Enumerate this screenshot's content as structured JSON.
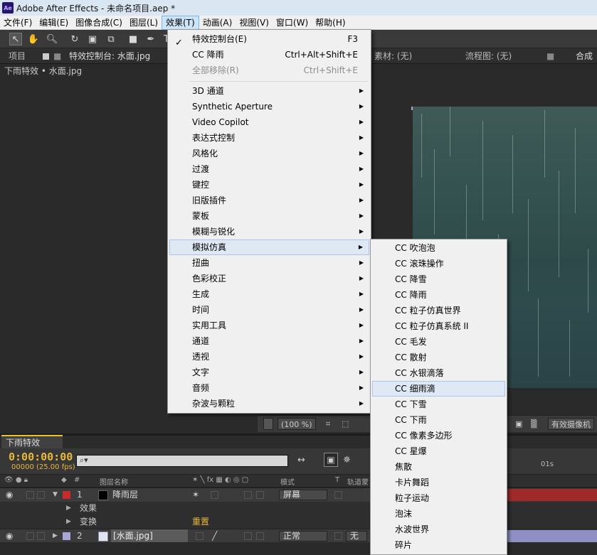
{
  "window": {
    "app_icon": "Ae",
    "title": "Adobe After Effects - 未命名项目.aep *"
  },
  "menubar": [
    "文件(F)",
    "编辑(E)",
    "图像合成(C)",
    "图层(L)",
    "效果(T)",
    "动画(A)",
    "视图(V)",
    "窗口(W)",
    "帮助(H)"
  ],
  "panels": {
    "project_tab": "项目",
    "effect_controls_tab": "特效控制台: 水面.jpg",
    "footage_tab": "素材: (无)",
    "flowchart_tab": "流程图: (无)",
    "composition_tab": "合成",
    "effect_controls_subtitle": "下雨特效 • 水面.jpg"
  },
  "viewer_footer": {
    "zoom": "(100 %)",
    "camera": "有效摄像机"
  },
  "timeline": {
    "tab": "下雨特效",
    "timecode": "0:00:00:00",
    "frame_info": "00000 (25.00 fps)",
    "search_placeholder": "",
    "header": {
      "layer_name": "图层名称",
      "mode": "模式",
      "t": "T",
      "trkmat": "轨道蒙"
    },
    "ruler_label": "01s",
    "layers": [
      {
        "index": "1",
        "name": "降雨层",
        "label_color": "#c82b2b",
        "mode": "屏幕"
      },
      {
        "index": "2",
        "name": "[水面.jpg]",
        "label_color": "#a7a7d6",
        "mode": "正常",
        "trkmat": "无"
      }
    ],
    "effects_label": "效果",
    "transform_label": "变换",
    "reset_label": "重置"
  },
  "effects_menu": {
    "items": [
      {
        "label": "特效控制台(E)",
        "shortcut": "F3",
        "checked": true
      },
      {
        "label": "CC 降雨",
        "shortcut": "Ctrl+Alt+Shift+E"
      },
      {
        "label": "全部移除(R)",
        "shortcut": "Ctrl+Shift+E",
        "disabled": true
      },
      {
        "label": "3D 通道",
        "submenu": true
      },
      {
        "label": "Synthetic Aperture",
        "submenu": true
      },
      {
        "label": "Video Copilot",
        "submenu": true
      },
      {
        "label": "表达式控制",
        "submenu": true
      },
      {
        "label": "风格化",
        "submenu": true
      },
      {
        "label": "过渡",
        "submenu": true
      },
      {
        "label": "键控",
        "submenu": true
      },
      {
        "label": "旧版插件",
        "submenu": true
      },
      {
        "label": "蒙板",
        "submenu": true
      },
      {
        "label": "模糊与锐化",
        "submenu": true
      },
      {
        "label": "模拟仿真",
        "submenu": true,
        "highlighted": true
      },
      {
        "label": "扭曲",
        "submenu": true
      },
      {
        "label": "色彩校正",
        "submenu": true
      },
      {
        "label": "生成",
        "submenu": true
      },
      {
        "label": "时间",
        "submenu": true
      },
      {
        "label": "实用工具",
        "submenu": true
      },
      {
        "label": "通道",
        "submenu": true
      },
      {
        "label": "透视",
        "submenu": true
      },
      {
        "label": "文字",
        "submenu": true
      },
      {
        "label": "音频",
        "submenu": true
      },
      {
        "label": "杂波与颗粒",
        "submenu": true
      }
    ]
  },
  "simulation_submenu": {
    "items": [
      "CC 吹泡泡",
      "CC 滚珠操作",
      "CC 降雪",
      "CC 降雨",
      "CC 粒子仿真世界",
      "CC 粒子仿真系统 II",
      "CC 毛发",
      "CC 散射",
      "CC 水银滴落",
      "CC 细雨滴",
      "CC 下雪",
      "CC 下雨",
      "CC 像素多边形",
      "CC 星爆",
      "焦散",
      "卡片舞蹈",
      "粒子运动",
      "泡沫",
      "水波世界",
      "碎片"
    ],
    "highlighted_index": 9
  }
}
